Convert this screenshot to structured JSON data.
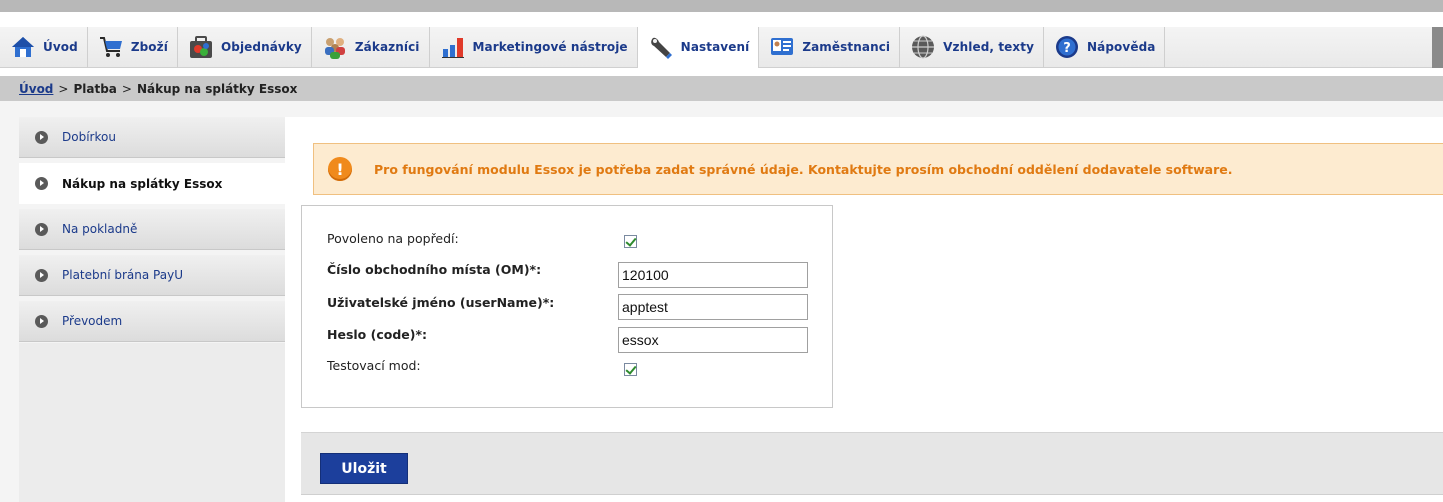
{
  "nav": {
    "items": [
      {
        "label": "Úvod",
        "icon": "home-icon"
      },
      {
        "label": "Zboží",
        "icon": "cart-icon"
      },
      {
        "label": "Objednávky",
        "icon": "orders-icon"
      },
      {
        "label": "Zákazníci",
        "icon": "customers-icon"
      },
      {
        "label": "Marketingové nástroje",
        "icon": "marketing-chart-icon"
      },
      {
        "label": "Nastavení",
        "icon": "wrench-icon"
      },
      {
        "label": "Zaměstnanci",
        "icon": "employees-icon"
      },
      {
        "label": "Vzhled, texty",
        "icon": "globe-icon"
      },
      {
        "label": "Nápověda",
        "icon": "help-icon"
      }
    ],
    "active_index": 5
  },
  "breadcrumb": {
    "home": "Úvod",
    "sep1": ">",
    "level1": "Platba",
    "sep2": ">",
    "current": "Nákup na splátky Essox"
  },
  "sidebar": {
    "items": [
      {
        "label": "Dobírkou"
      },
      {
        "label": "Nákup na splátky Essox"
      },
      {
        "label": "Na pokladně"
      },
      {
        "label": "Platební brána PayU"
      },
      {
        "label": "Převodem"
      }
    ],
    "active_index": 1
  },
  "warning": {
    "icon_text": "!",
    "text": "Pro fungování modulu Essox je potřeba zadat správné údaje. Kontaktujte prosím obchodní oddělení dodavatele software."
  },
  "form": {
    "enabled_label": "Povoleno na popředí:",
    "enabled_checked": true,
    "om_label": "Číslo obchodního místa (OM)*:",
    "om_value": "120100",
    "username_label": "Uživatelské jméno (userName)*:",
    "username_value": "apptest",
    "code_label": "Heslo (code)*:",
    "code_value": "essox",
    "test_label": "Testovací mod:",
    "test_checked": true
  },
  "actions": {
    "save_label": "Uložit"
  },
  "colors": {
    "accent": "#1c3f9c",
    "warning_text": "#e07a12",
    "warning_bg": "#fdebd0"
  }
}
